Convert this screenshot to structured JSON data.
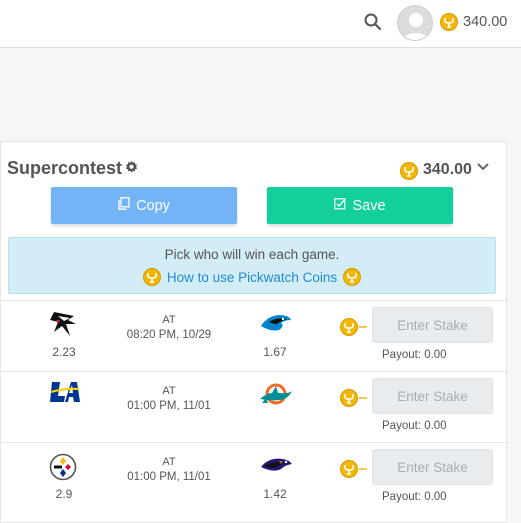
{
  "header": {
    "balance": "340.00",
    "icons": {
      "search": "search-icon",
      "avatar": "user-avatar",
      "coin": "coin-icon"
    }
  },
  "contest": {
    "title": "Supercontest",
    "balance": "340.00",
    "copy_label": "Copy",
    "save_label": "Save",
    "info_text": "Pick who will win each game.",
    "info_link": "How to use Pickwatch Coins"
  },
  "games": [
    {
      "away_team": "Falcons",
      "away_odds": "2.23",
      "at": "AT",
      "time": "08:20 PM, 10/29",
      "home_team": "Panthers",
      "home_odds": "1.67",
      "stake_placeholder": "Enter Stake",
      "payout": "Payout: 0.00"
    },
    {
      "away_team": "Rams",
      "away_odds": "",
      "at": "AT",
      "time": "01:00 PM, 11/01",
      "home_team": "Dolphins",
      "home_odds": "",
      "stake_placeholder": "Enter Stake",
      "payout": "Payout: 0.00"
    },
    {
      "away_team": "Steelers",
      "away_odds": "2.9",
      "at": "AT",
      "time": "01:00 PM, 11/01",
      "home_team": "Ravens",
      "home_odds": "1.42",
      "stake_placeholder": "Enter Stake",
      "payout": "Payout: 0.00"
    }
  ],
  "colors": {
    "copy": "#73b4f6",
    "save": "#13cf9a",
    "coin": "#f2b705",
    "info_bg": "#d3edf6",
    "link": "#1f8ad6"
  }
}
